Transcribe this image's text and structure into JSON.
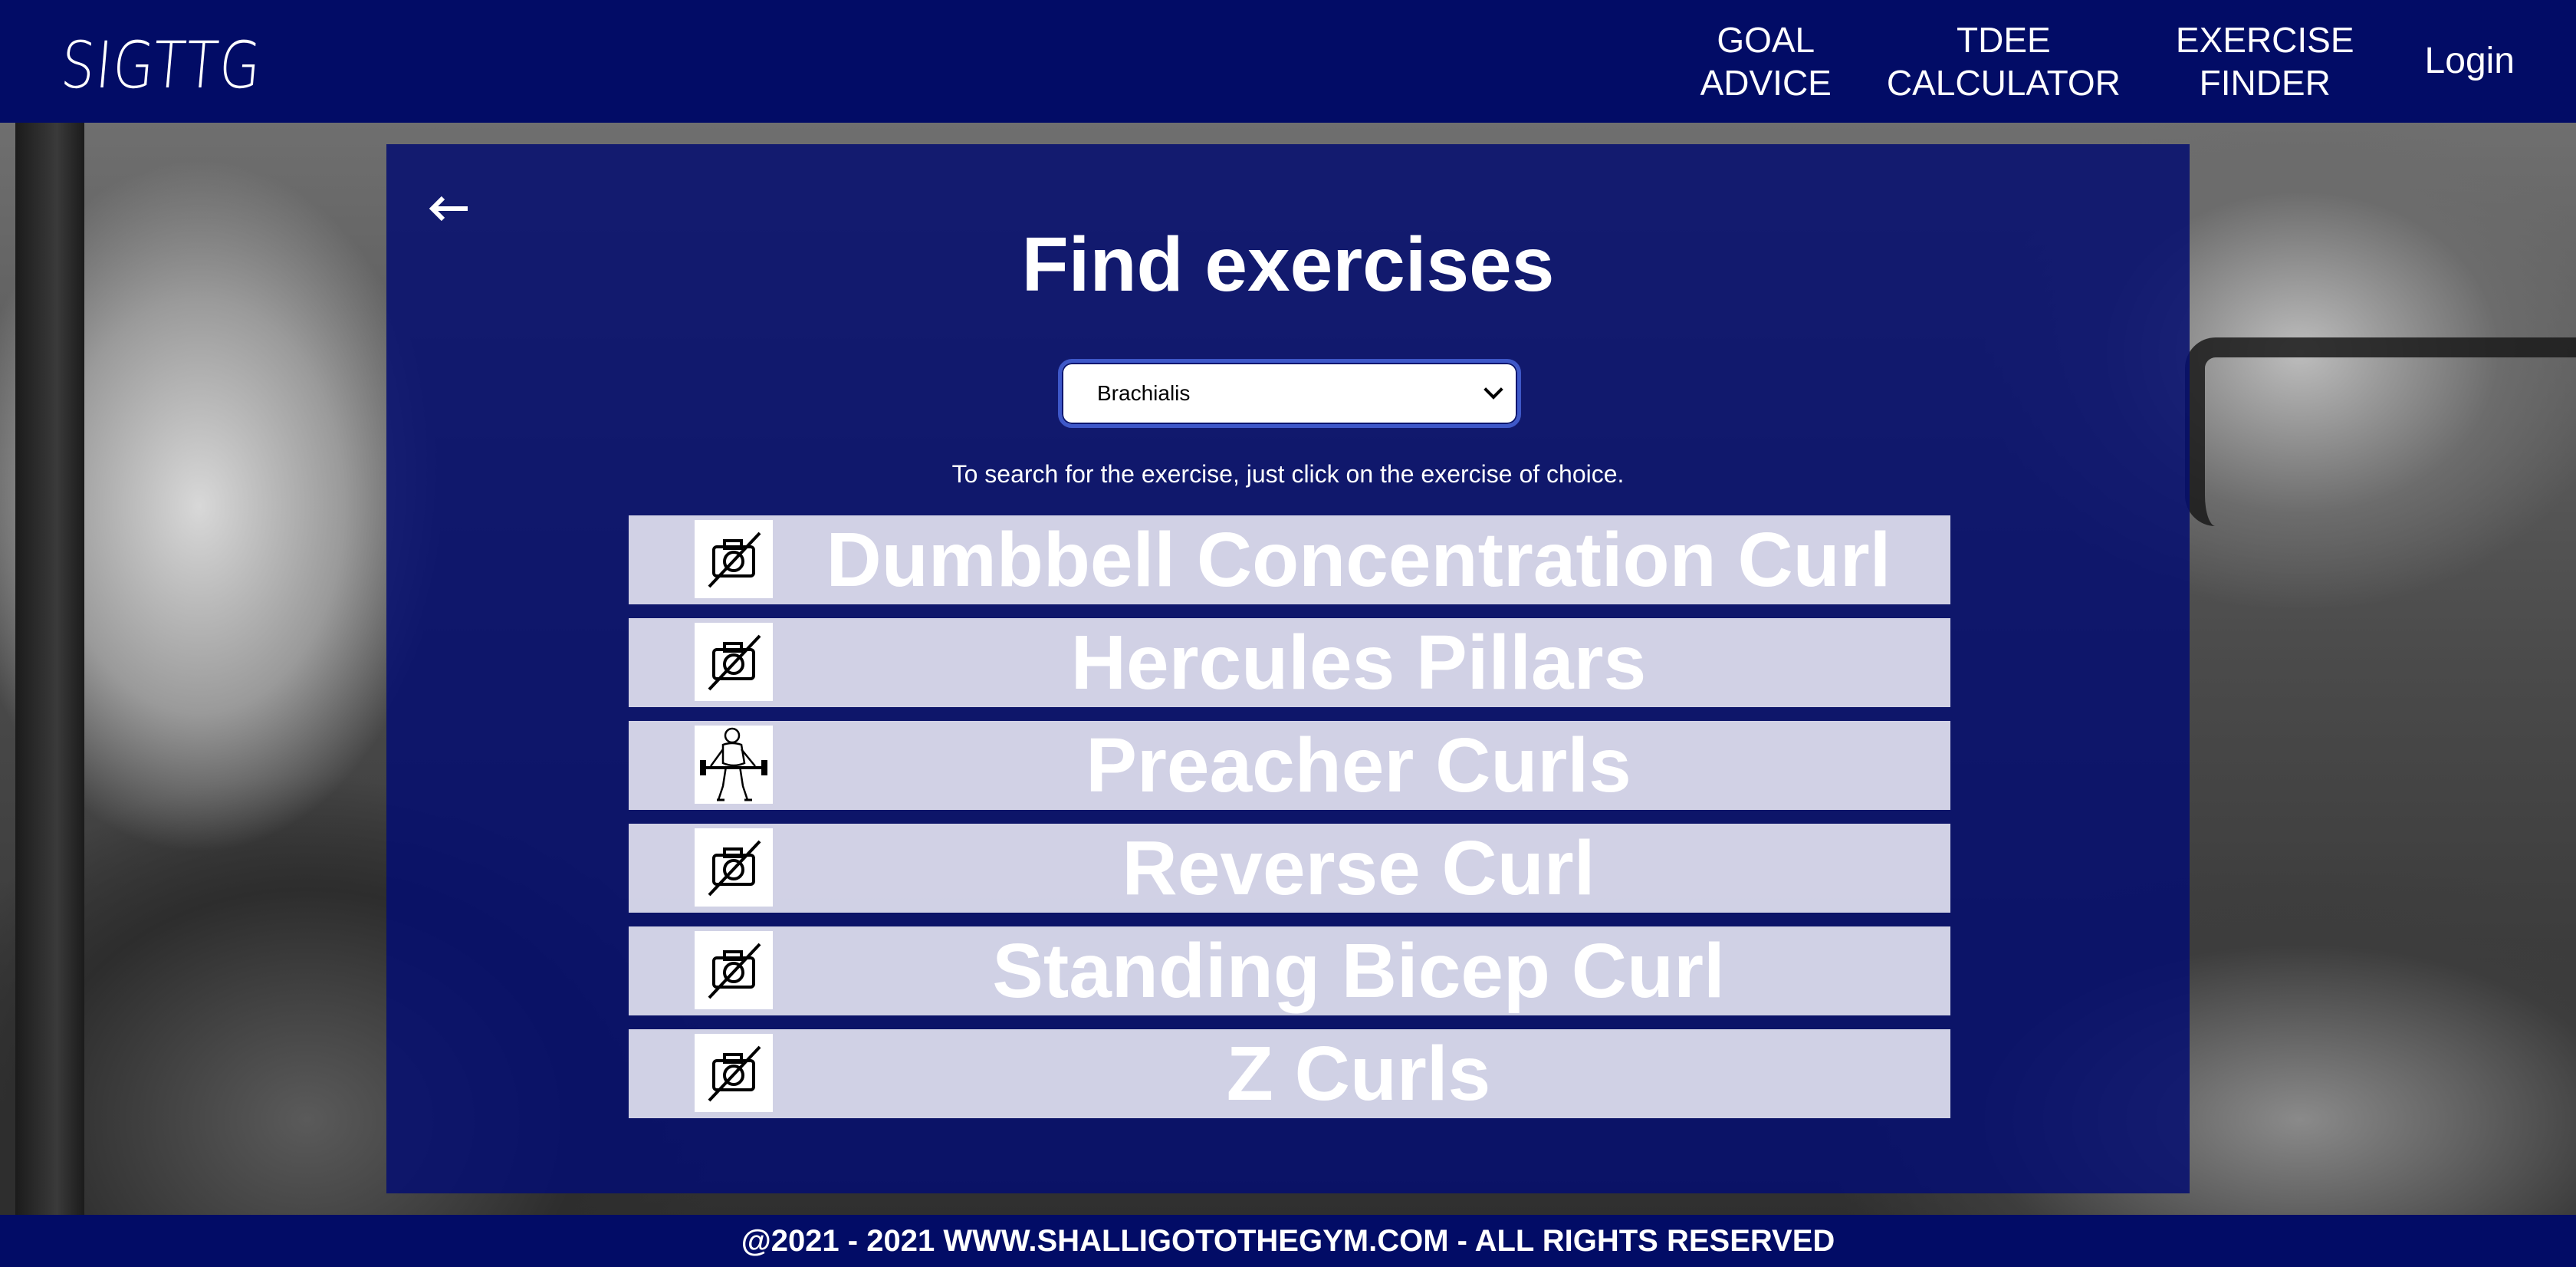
{
  "header": {
    "logo": "SIGTTG",
    "nav": [
      {
        "line1": "GOAL",
        "line2": "ADVICE"
      },
      {
        "line1": "TDEE",
        "line2": "CALCULATOR"
      },
      {
        "line1": "EXERCISE",
        "line2": "FINDER"
      }
    ],
    "login": "Login"
  },
  "main": {
    "title": "Find exercises",
    "select": {
      "value": "Brachialis"
    },
    "hint": "To search for the exercise, just click on the exercise of choice.",
    "exercises": [
      {
        "name": "Dumbbell Concentration Curl",
        "icon": "no-image-icon"
      },
      {
        "name": "Hercules Pillars",
        "icon": "no-image-icon"
      },
      {
        "name": "Preacher Curls",
        "icon": "exercise-illustration-icon"
      },
      {
        "name": "Reverse Curl",
        "icon": "no-image-icon"
      },
      {
        "name": "Standing Bicep Curl",
        "icon": "no-image-icon"
      },
      {
        "name": "Z Curls",
        "icon": "no-image-icon"
      }
    ]
  },
  "footer": {
    "text": "@2021 - 2021 WWW.SHALLIGOTOTHEGYM.COM - ALL RIGHTS RESERVED"
  },
  "colors": {
    "header_bg": "#020c66",
    "panel_bg": "#050e70",
    "row_bg": "#e2e2f0"
  }
}
